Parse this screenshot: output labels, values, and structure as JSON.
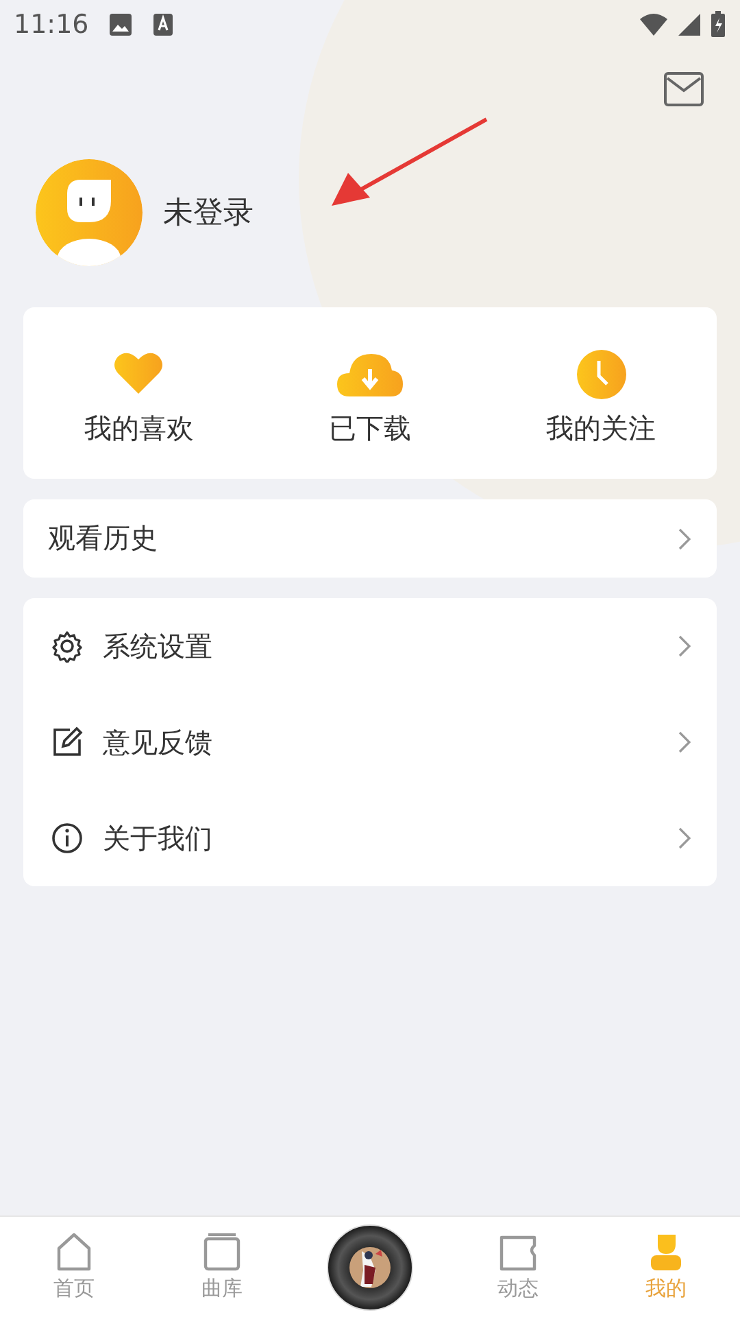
{
  "status_bar": {
    "time": "11:16"
  },
  "profile": {
    "name": "未登录"
  },
  "quick_actions": [
    {
      "kind": "favorite",
      "label": "我的喜欢"
    },
    {
      "kind": "download",
      "label": "已下载"
    },
    {
      "kind": "following",
      "label": "我的关注"
    }
  ],
  "history": {
    "label": "观看历史"
  },
  "menu": [
    {
      "kind": "settings",
      "label": "系统设置"
    },
    {
      "kind": "feedback",
      "label": "意见反馈"
    },
    {
      "kind": "about",
      "label": "关于我们"
    }
  ],
  "nav_tabs": [
    {
      "kind": "home",
      "label": "首页",
      "selected": false
    },
    {
      "kind": "library",
      "label": "曲库",
      "selected": false
    },
    {
      "kind": "feed",
      "label": "动态",
      "selected": false
    },
    {
      "kind": "mine",
      "label": "我的",
      "selected": true
    }
  ]
}
